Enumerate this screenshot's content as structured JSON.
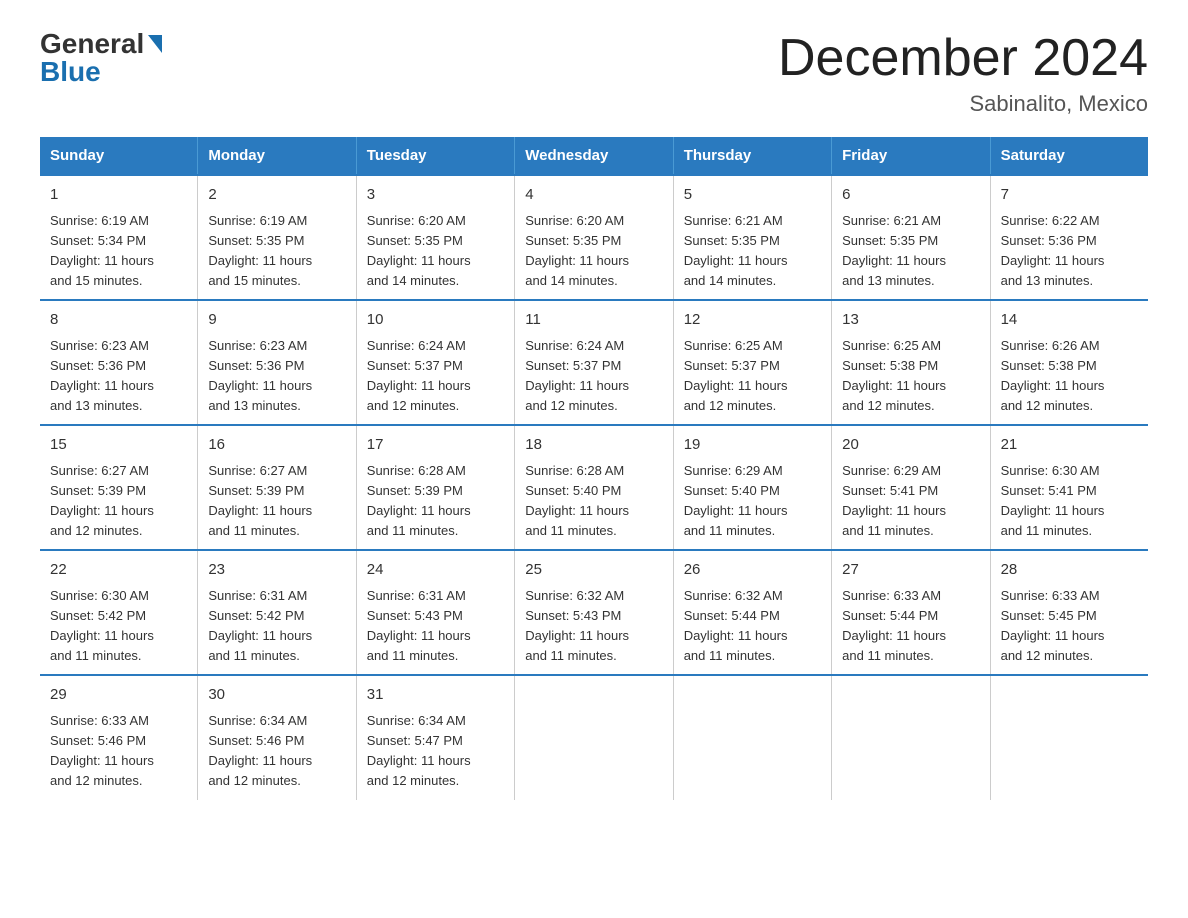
{
  "logo": {
    "general": "General",
    "blue": "Blue"
  },
  "title": "December 2024",
  "subtitle": "Sabinalito, Mexico",
  "days_of_week": [
    "Sunday",
    "Monday",
    "Tuesday",
    "Wednesday",
    "Thursday",
    "Friday",
    "Saturday"
  ],
  "weeks": [
    [
      {
        "day": "1",
        "info": "Sunrise: 6:19 AM\nSunset: 5:34 PM\nDaylight: 11 hours\nand 15 minutes."
      },
      {
        "day": "2",
        "info": "Sunrise: 6:19 AM\nSunset: 5:35 PM\nDaylight: 11 hours\nand 15 minutes."
      },
      {
        "day": "3",
        "info": "Sunrise: 6:20 AM\nSunset: 5:35 PM\nDaylight: 11 hours\nand 14 minutes."
      },
      {
        "day": "4",
        "info": "Sunrise: 6:20 AM\nSunset: 5:35 PM\nDaylight: 11 hours\nand 14 minutes."
      },
      {
        "day": "5",
        "info": "Sunrise: 6:21 AM\nSunset: 5:35 PM\nDaylight: 11 hours\nand 14 minutes."
      },
      {
        "day": "6",
        "info": "Sunrise: 6:21 AM\nSunset: 5:35 PM\nDaylight: 11 hours\nand 13 minutes."
      },
      {
        "day": "7",
        "info": "Sunrise: 6:22 AM\nSunset: 5:36 PM\nDaylight: 11 hours\nand 13 minutes."
      }
    ],
    [
      {
        "day": "8",
        "info": "Sunrise: 6:23 AM\nSunset: 5:36 PM\nDaylight: 11 hours\nand 13 minutes."
      },
      {
        "day": "9",
        "info": "Sunrise: 6:23 AM\nSunset: 5:36 PM\nDaylight: 11 hours\nand 13 minutes."
      },
      {
        "day": "10",
        "info": "Sunrise: 6:24 AM\nSunset: 5:37 PM\nDaylight: 11 hours\nand 12 minutes."
      },
      {
        "day": "11",
        "info": "Sunrise: 6:24 AM\nSunset: 5:37 PM\nDaylight: 11 hours\nand 12 minutes."
      },
      {
        "day": "12",
        "info": "Sunrise: 6:25 AM\nSunset: 5:37 PM\nDaylight: 11 hours\nand 12 minutes."
      },
      {
        "day": "13",
        "info": "Sunrise: 6:25 AM\nSunset: 5:38 PM\nDaylight: 11 hours\nand 12 minutes."
      },
      {
        "day": "14",
        "info": "Sunrise: 6:26 AM\nSunset: 5:38 PM\nDaylight: 11 hours\nand 12 minutes."
      }
    ],
    [
      {
        "day": "15",
        "info": "Sunrise: 6:27 AM\nSunset: 5:39 PM\nDaylight: 11 hours\nand 12 minutes."
      },
      {
        "day": "16",
        "info": "Sunrise: 6:27 AM\nSunset: 5:39 PM\nDaylight: 11 hours\nand 11 minutes."
      },
      {
        "day": "17",
        "info": "Sunrise: 6:28 AM\nSunset: 5:39 PM\nDaylight: 11 hours\nand 11 minutes."
      },
      {
        "day": "18",
        "info": "Sunrise: 6:28 AM\nSunset: 5:40 PM\nDaylight: 11 hours\nand 11 minutes."
      },
      {
        "day": "19",
        "info": "Sunrise: 6:29 AM\nSunset: 5:40 PM\nDaylight: 11 hours\nand 11 minutes."
      },
      {
        "day": "20",
        "info": "Sunrise: 6:29 AM\nSunset: 5:41 PM\nDaylight: 11 hours\nand 11 minutes."
      },
      {
        "day": "21",
        "info": "Sunrise: 6:30 AM\nSunset: 5:41 PM\nDaylight: 11 hours\nand 11 minutes."
      }
    ],
    [
      {
        "day": "22",
        "info": "Sunrise: 6:30 AM\nSunset: 5:42 PM\nDaylight: 11 hours\nand 11 minutes."
      },
      {
        "day": "23",
        "info": "Sunrise: 6:31 AM\nSunset: 5:42 PM\nDaylight: 11 hours\nand 11 minutes."
      },
      {
        "day": "24",
        "info": "Sunrise: 6:31 AM\nSunset: 5:43 PM\nDaylight: 11 hours\nand 11 minutes."
      },
      {
        "day": "25",
        "info": "Sunrise: 6:32 AM\nSunset: 5:43 PM\nDaylight: 11 hours\nand 11 minutes."
      },
      {
        "day": "26",
        "info": "Sunrise: 6:32 AM\nSunset: 5:44 PM\nDaylight: 11 hours\nand 11 minutes."
      },
      {
        "day": "27",
        "info": "Sunrise: 6:33 AM\nSunset: 5:44 PM\nDaylight: 11 hours\nand 11 minutes."
      },
      {
        "day": "28",
        "info": "Sunrise: 6:33 AM\nSunset: 5:45 PM\nDaylight: 11 hours\nand 12 minutes."
      }
    ],
    [
      {
        "day": "29",
        "info": "Sunrise: 6:33 AM\nSunset: 5:46 PM\nDaylight: 11 hours\nand 12 minutes."
      },
      {
        "day": "30",
        "info": "Sunrise: 6:34 AM\nSunset: 5:46 PM\nDaylight: 11 hours\nand 12 minutes."
      },
      {
        "day": "31",
        "info": "Sunrise: 6:34 AM\nSunset: 5:47 PM\nDaylight: 11 hours\nand 12 minutes."
      },
      {
        "day": "",
        "info": ""
      },
      {
        "day": "",
        "info": ""
      },
      {
        "day": "",
        "info": ""
      },
      {
        "day": "",
        "info": ""
      }
    ]
  ]
}
